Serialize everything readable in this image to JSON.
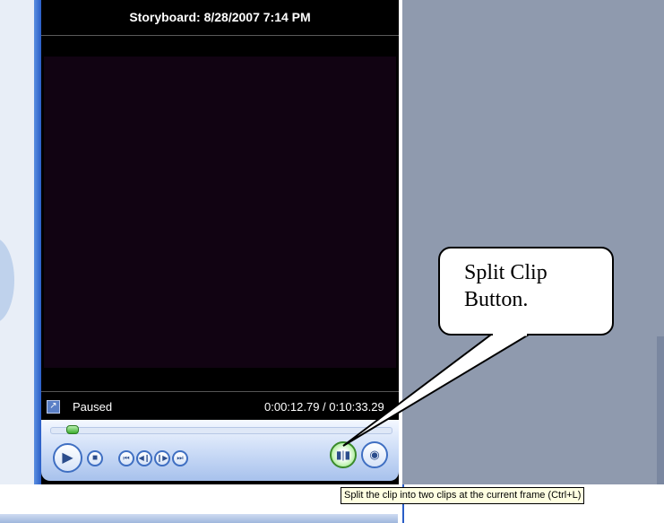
{
  "monitor": {
    "title": "Storyboard: 8/28/2007 7:14 PM",
    "status": "Paused",
    "time": "0:00:12.79 / 0:10:33.29",
    "seek_progress": 0.05
  },
  "controls": {
    "play_icon": "play-icon",
    "stop_icon": "stop-icon",
    "prev_icon": "previous-frame-icon",
    "back_icon": "rewind-icon",
    "forward_icon": "forward-icon",
    "next_icon": "next-frame-icon",
    "split_icon": "split-clip-icon",
    "snapshot_icon": "camera-icon"
  },
  "callout": {
    "line1": "Split Clip",
    "line2": "Button."
  },
  "tooltip": {
    "text": "Split the clip into two clips at the current frame (Ctrl+L)"
  },
  "colors": {
    "accent": "#2a5ec7",
    "split_button": "#6fcf55",
    "tooltip_bg": "#ffffe1"
  }
}
